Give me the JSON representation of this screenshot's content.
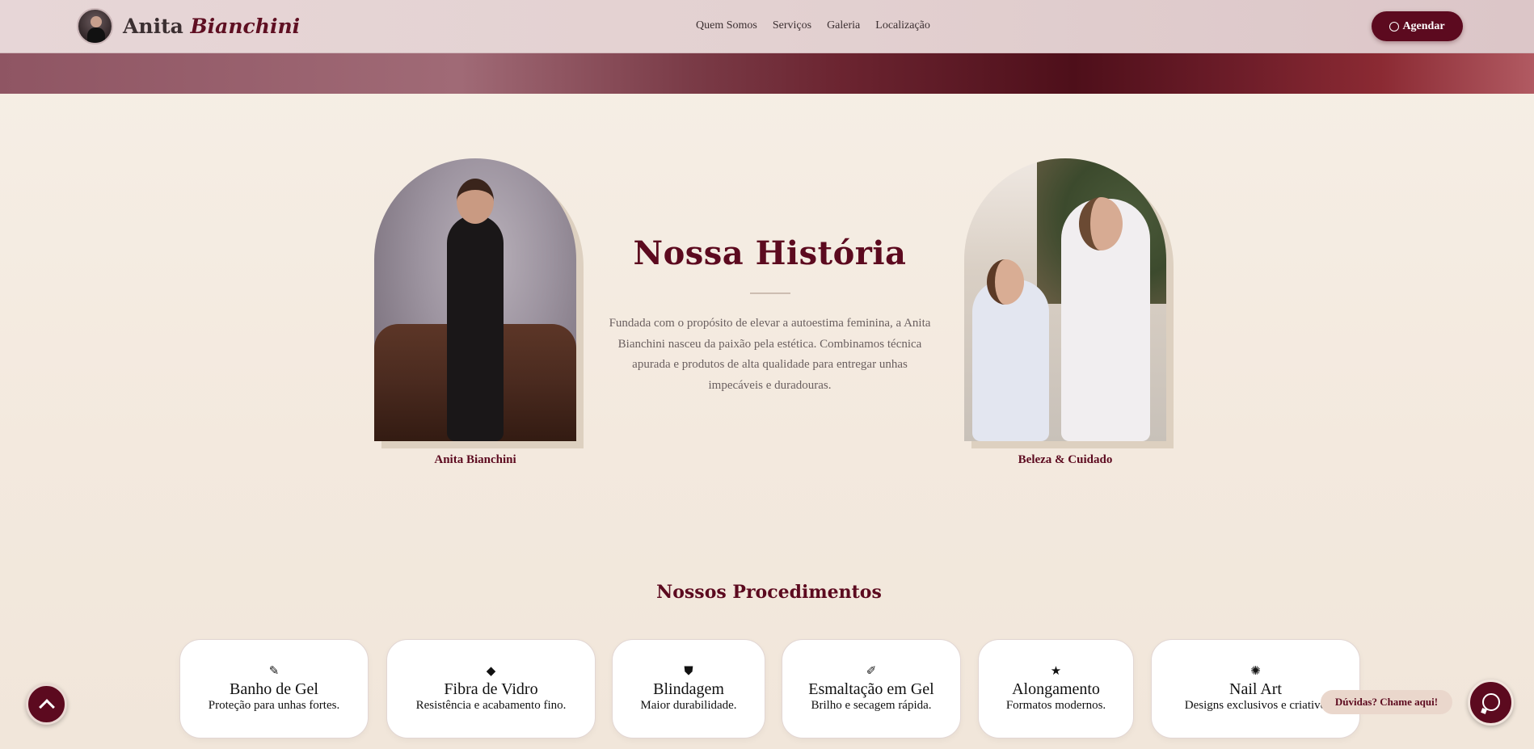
{
  "header": {
    "brand_first": "Anita",
    "brand_second": "Bianchini",
    "nav": [
      "Quem Somos",
      "Serviços",
      "Galeria",
      "Localização"
    ],
    "cta_label": "Agendar",
    "cta_icon": "whatsapp-icon"
  },
  "story": {
    "photo_left_caption": "Anita Bianchini",
    "photo_right_caption": "Beleza & Cuidado",
    "title": "Nossa História",
    "text": "Fundada com o propósito de elevar a autoestima feminina, a Anita Bianchini nasceu da paixão pela estética. Combinamos técnica apurada e produtos de alta qualidade para entregar unhas impecáveis e duradouras."
  },
  "procedures": {
    "title": "Nossos Procedimentos",
    "items": [
      {
        "icon": "brush-icon",
        "title": "Banho de Gel",
        "desc": "Proteção para unhas fortes."
      },
      {
        "icon": "gem-icon",
        "title": "Fibra de Vidro",
        "desc": "Resistência e acabamento fino."
      },
      {
        "icon": "shield-icon",
        "title": "Blindagem",
        "desc": "Maior durabilidade."
      },
      {
        "icon": "paintbrush-icon",
        "title": "Esmaltação em Gel",
        "desc": "Brilho e secagem rápida."
      },
      {
        "icon": "star-icon",
        "title": "Alongamento",
        "desc": "Formatos modernos."
      },
      {
        "icon": "palette-icon",
        "title": "Nail Art",
        "desc": "Designs exclusivos e criativo"
      }
    ]
  },
  "floating": {
    "chat_label": "Dúvidas? Chame aqui!"
  },
  "colors": {
    "brand": "#5c0a1f",
    "background": "#f3e9de"
  }
}
